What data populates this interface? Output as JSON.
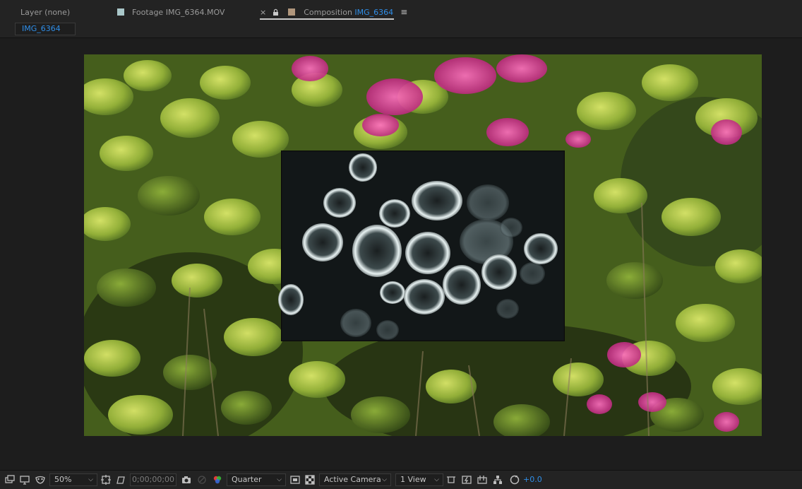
{
  "tabs": {
    "layer": "Layer (none)",
    "footage_prefix": "Footage",
    "footage_name": "IMG_6364.MOV",
    "comp_close": "×",
    "comp_prefix": "Composition",
    "comp_name": "IMG_6364",
    "menu": "≡"
  },
  "breadcrumb": "IMG_6364",
  "toolbar": {
    "zoom": "50%",
    "timecode": "0;00;00;00",
    "resolution": "Quarter",
    "camera": "Active Camera",
    "views": "1 View",
    "exposure": "+0.0"
  },
  "colors": {
    "accent": "#2f8ee8",
    "panel": "#232323",
    "viewer_bg": "#1d1d1d",
    "footage_label": "#a9c7c9",
    "composition_label": "#b0967c"
  }
}
